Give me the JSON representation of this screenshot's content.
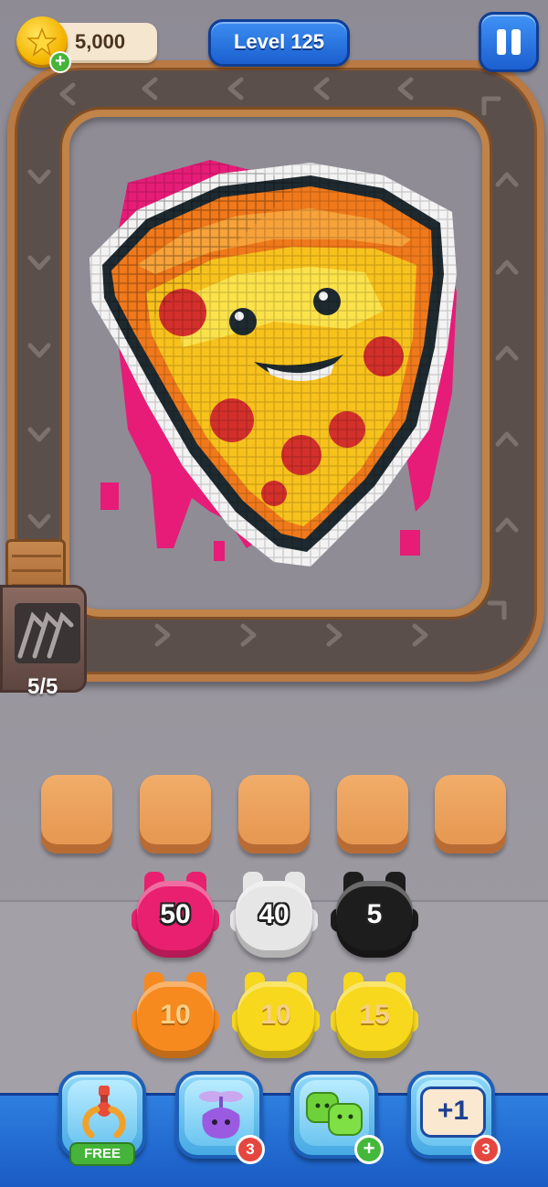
{
  "header": {
    "coins": "5,000",
    "level": "Level 125"
  },
  "conveyor": {
    "counter": "5/5"
  },
  "slots": {
    "count": 5
  },
  "shooters": [
    {
      "value": "50",
      "color": "#e8206f"
    },
    {
      "value": "40",
      "color": "#e6e6e6"
    },
    {
      "value": "5",
      "color": "#1d1d1d"
    },
    {
      "value": "10",
      "color": "#f68a1e",
      "dim": true
    },
    {
      "value": "10",
      "color": "#f7d81c",
      "dim": true
    },
    {
      "value": "15",
      "color": "#f7d81c",
      "dim": true
    }
  ],
  "boosters": [
    {
      "name": "claw",
      "tag": "FREE"
    },
    {
      "name": "fan",
      "count": "3"
    },
    {
      "name": "jelly",
      "badge": "+"
    },
    {
      "name": "extra-slot",
      "label": "+1",
      "count": "3"
    }
  ],
  "artwork": {
    "subject": "pizza-slice",
    "palette": {
      "outline": "#1e2a30",
      "white": "#f3f3f3",
      "crust": "#f0791b",
      "crust_light": "#f7a23a",
      "cheese": "#f8c21d",
      "cheese_light": "#fbe24a",
      "pepperoni": "#d3302b",
      "pink": "#e61c78"
    }
  }
}
